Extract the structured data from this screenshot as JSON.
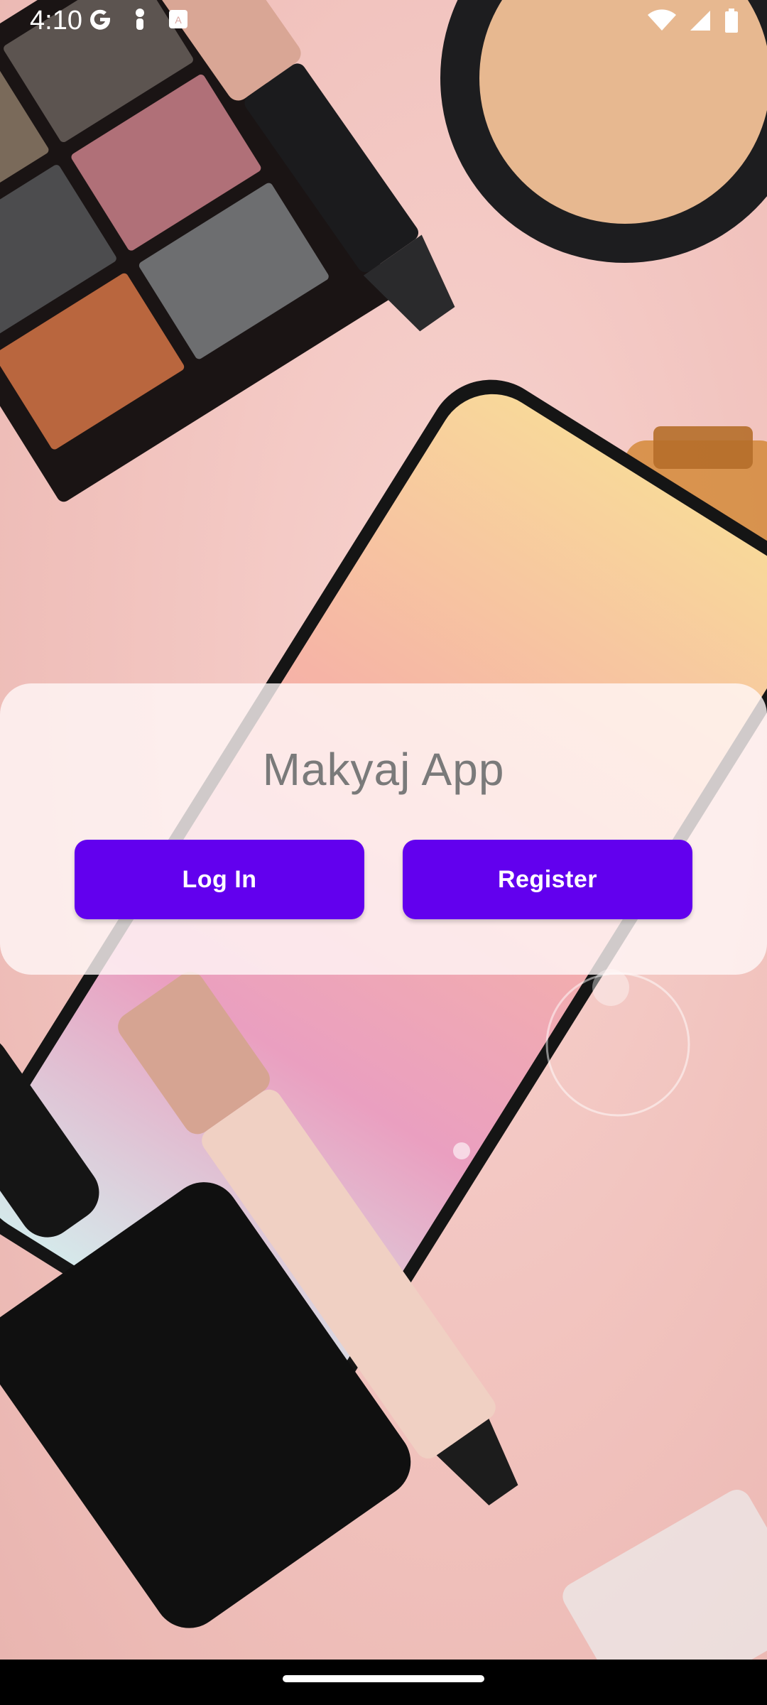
{
  "status_bar": {
    "time": "4:10",
    "left_icons": [
      "google-g-icon",
      "notification-icon",
      "app-store-icon"
    ],
    "right_icons": [
      "wifi-icon",
      "signal-icon",
      "battery-icon"
    ]
  },
  "background": {
    "description_icon": "cosmetics-background-image"
  },
  "card": {
    "title": "Makyaj App",
    "login_label": "Log In",
    "register_label": "Register"
  },
  "colors": {
    "accent": "#6200ee",
    "title_text": "#7a7a7a",
    "card_bg": "#fff8f8"
  },
  "nav_bar": {
    "home_indicator": "home-indicator"
  }
}
